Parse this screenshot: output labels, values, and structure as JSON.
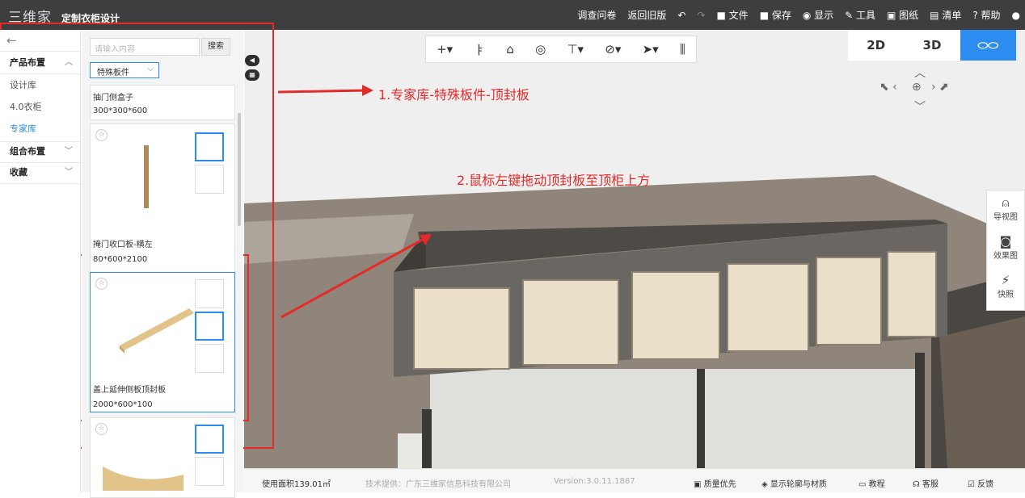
{
  "topbar": {
    "logo": "三维家",
    "title": "定制衣柜设计",
    "menu": [
      {
        "icon": "survey",
        "label": "调查问卷"
      },
      {
        "icon": "return",
        "label": "返回旧版"
      },
      {
        "icon": "undo-icon",
        "label": "↶"
      },
      {
        "icon": "redo-icon",
        "label": "↷"
      },
      {
        "icon": "folder-icon",
        "label": "■ 文件"
      },
      {
        "icon": "save-icon",
        "label": "■ 保存"
      },
      {
        "icon": "eye-icon",
        "label": "◉ 显示"
      },
      {
        "icon": "wrench-icon",
        "label": "✎ 工具"
      },
      {
        "icon": "drawing-icon",
        "label": "▣ 图纸"
      },
      {
        "icon": "list-icon",
        "label": "▤ 清单"
      },
      {
        "icon": "help-icon",
        "label": "? 帮助"
      },
      {
        "icon": "user-icon",
        "label": "●"
      }
    ]
  },
  "nav": {
    "back": "←",
    "items": [
      {
        "label": "产品布置",
        "type": "group",
        "chev": "︿"
      },
      {
        "label": "设计库",
        "type": "sub"
      },
      {
        "label": "4.0衣柜",
        "type": "sub"
      },
      {
        "label": "专家库",
        "type": "active"
      },
      {
        "label": "组合布置",
        "type": "group",
        "chev": "﹀"
      },
      {
        "label": "收藏",
        "type": "group",
        "chev": "﹀"
      }
    ]
  },
  "panel": {
    "search_placeholder": "请输入内容",
    "search_button": "搜索",
    "filter": "特殊板件",
    "filter_arrow": "⌵",
    "cards": [
      {
        "name": "抽门侧盒子",
        "size": "300*300*600"
      },
      {
        "name": "掩门收口板-横左",
        "size": "80*600*2100"
      },
      {
        "name": "盖上延伸侧板顶封板",
        "size": "2000*600*100"
      }
    ],
    "star": "☆"
  },
  "toolbar": {
    "items": [
      "+▾",
      "ㅑ",
      "⌂",
      "◎",
      "⊤▾",
      "⊘▾",
      "➤▾",
      "⫼"
    ]
  },
  "view": {
    "items": [
      "2D",
      "3D",
      "⬭⬭"
    ],
    "active_index": 2
  },
  "navctl": {
    "up": "︿",
    "left": "⬉ ‹",
    "center": "⊕",
    "right": "› ⬈",
    "down": "﹀"
  },
  "sidetools": [
    {
      "icon": "navigate-icon",
      "glyph": "⍝",
      "label": "导视图"
    },
    {
      "icon": "camera-icon",
      "glyph": "◙",
      "label": "效果图"
    },
    {
      "icon": "snapshot-icon",
      "glyph": "⚡",
      "label": "快照"
    }
  ],
  "bottom": {
    "area": "使用面积139.01㎡",
    "provider": "技术提供：广东三维家信息科技有限公司",
    "version": "Version:3.0.11.1867",
    "quality": "▣ 质量优先",
    "outline": "◈ 显示轮廓与材质",
    "tutorial": "▭ 教程",
    "service": "☊ 客服",
    "feedback": "☑ 反馈"
  },
  "annotations": {
    "step1": "1.专家库-特殊板件-顶封板",
    "step2": "2.鼠标左键拖动顶封板至顶柜上方"
  },
  "colors": {
    "accent": "#2d8cf0",
    "annotation": "#e52a2a",
    "topbar": "#3e3e3e"
  }
}
